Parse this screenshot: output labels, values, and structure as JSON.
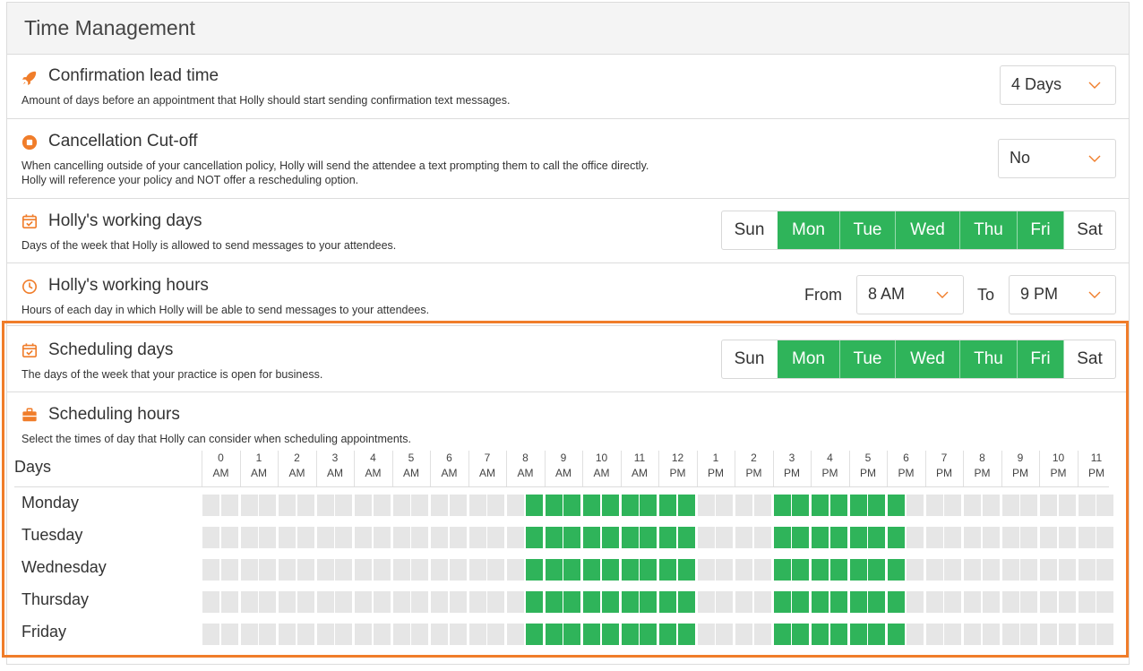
{
  "panel": {
    "title": "Time Management"
  },
  "settings": {
    "confirmation": {
      "title": "Confirmation lead time",
      "desc": "Amount of days before an appointment that Holly should start sending confirmation text messages.",
      "value": "4 Days",
      "icon": "rocket-icon"
    },
    "cancellation": {
      "title": "Cancellation Cut-off",
      "desc": "When cancelling outside of your cancellation policy, Holly will send the attendee a text prompting them to call the office directly. Holly will reference your policy and NOT offer a rescheduling option.",
      "value": "No",
      "icon": "stop-icon"
    },
    "working_days": {
      "title": "Holly's working days",
      "desc": "Days of the week that Holly is allowed to send messages to your attendees.",
      "icon": "calendar-check-icon"
    },
    "working_hours": {
      "title": "Holly's working hours",
      "desc": "Hours of each day in which Holly will be able to send messages to your attendees.",
      "from_label": "From",
      "from_value": "8 AM",
      "to_label": "To",
      "to_value": "9 PM",
      "icon": "clock-icon"
    },
    "scheduling_days": {
      "title": "Scheduling days",
      "desc": "The days of the week that your practice is open for business.",
      "icon": "calendar-check-icon"
    },
    "scheduling_hours": {
      "title": "Scheduling hours",
      "desc": "Select the times of day that Holly can consider when scheduling appointments.",
      "days_header": "Days",
      "icon": "briefcase-icon"
    }
  },
  "days_of_week": [
    {
      "label": "Sun",
      "on": false
    },
    {
      "label": "Mon",
      "on": true
    },
    {
      "label": "Tue",
      "on": true
    },
    {
      "label": "Wed",
      "on": true
    },
    {
      "label": "Thu",
      "on": true
    },
    {
      "label": "Fri",
      "on": true
    },
    {
      "label": "Sat",
      "on": false
    }
  ],
  "hours": [
    {
      "h": "0",
      "p": "AM"
    },
    {
      "h": "1",
      "p": "AM"
    },
    {
      "h": "2",
      "p": "AM"
    },
    {
      "h": "3",
      "p": "AM"
    },
    {
      "h": "4",
      "p": "AM"
    },
    {
      "h": "5",
      "p": "AM"
    },
    {
      "h": "6",
      "p": "AM"
    },
    {
      "h": "7",
      "p": "AM"
    },
    {
      "h": "8",
      "p": "AM"
    },
    {
      "h": "9",
      "p": "AM"
    },
    {
      "h": "10",
      "p": "AM"
    },
    {
      "h": "11",
      "p": "AM"
    },
    {
      "h": "12",
      "p": "PM"
    },
    {
      "h": "1",
      "p": "PM"
    },
    {
      "h": "2",
      "p": "PM"
    },
    {
      "h": "3",
      "p": "PM"
    },
    {
      "h": "4",
      "p": "PM"
    },
    {
      "h": "5",
      "p": "PM"
    },
    {
      "h": "6",
      "p": "PM"
    },
    {
      "h": "7",
      "p": "PM"
    },
    {
      "h": "8",
      "p": "PM"
    },
    {
      "h": "9",
      "p": "PM"
    },
    {
      "h": "10",
      "p": "PM"
    },
    {
      "h": "11",
      "p": "PM"
    }
  ],
  "schedule_rows": [
    {
      "day": "Monday"
    },
    {
      "day": "Tuesday"
    },
    {
      "day": "Wednesday"
    },
    {
      "day": "Thursday"
    },
    {
      "day": "Friday"
    }
  ],
  "selected_half_hours": [
    17,
    18,
    19,
    20,
    21,
    22,
    23,
    24,
    25,
    30,
    31,
    32,
    33,
    34,
    35,
    36
  ],
  "colors": {
    "accent": "#f07d2a",
    "active": "#2fb45a",
    "inactive": "#e6e6e6"
  }
}
